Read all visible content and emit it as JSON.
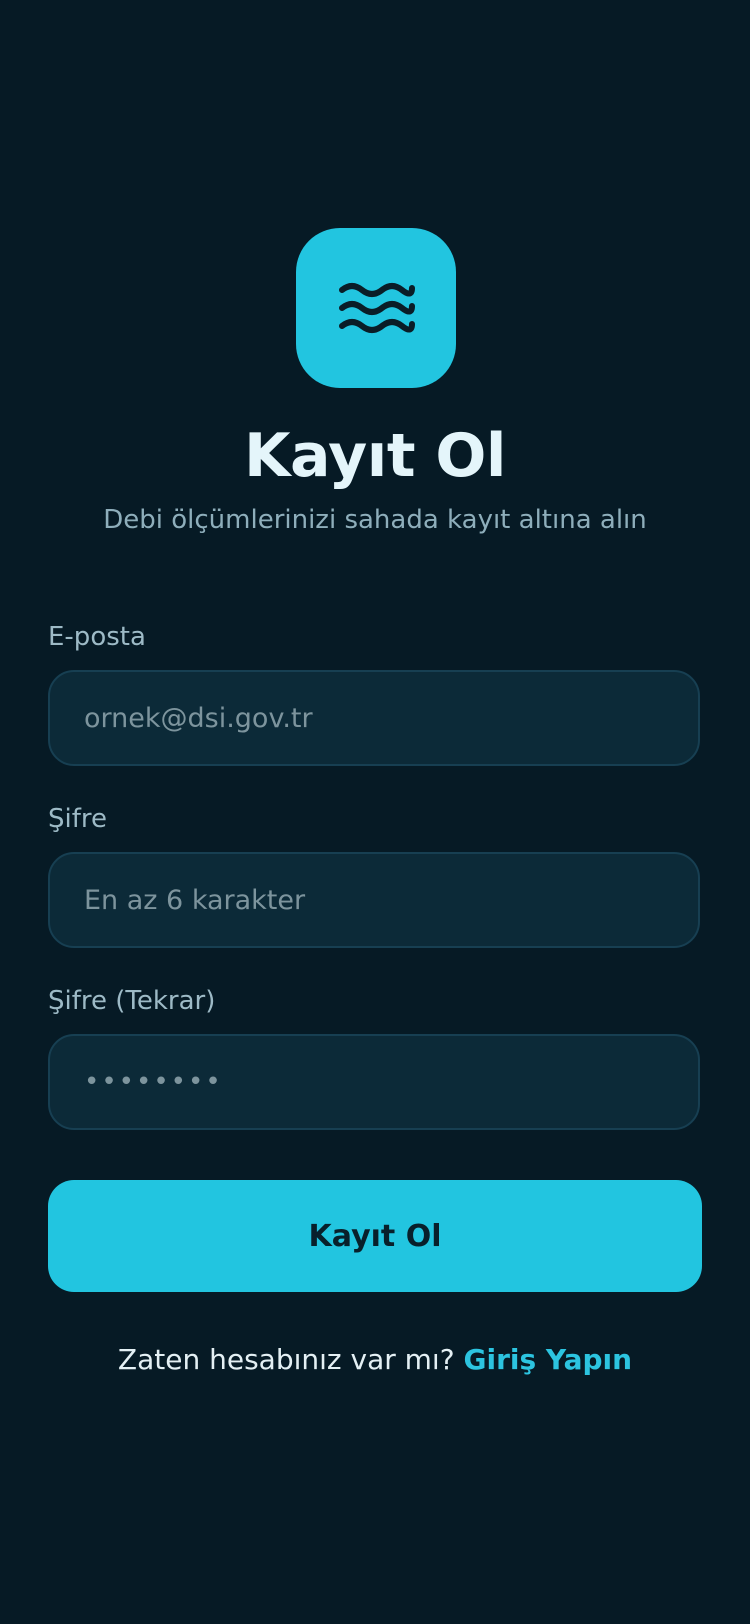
{
  "header": {
    "logo_icon": "waves-icon",
    "title": "Kayıt Ol",
    "subtitle": "Debi ölçümlerinizi sahada kayıt altına alın"
  },
  "form": {
    "email": {
      "label": "E-posta",
      "placeholder": "ornek@dsi.gov.tr"
    },
    "password": {
      "label": "Şifre",
      "placeholder": "En az 6 karakter"
    },
    "password_confirm": {
      "label": "Şifre (Tekrar)",
      "placeholder": "••••••••"
    },
    "submit_label": "Kayıt Ol"
  },
  "footer": {
    "prompt": "Zaten hesabınız var mı?",
    "login_link": "Giriş Yapın"
  },
  "colors": {
    "background": "#061a25",
    "accent": "#22c5e0",
    "field_bg": "#0c2a38",
    "field_border": "#173f52"
  }
}
